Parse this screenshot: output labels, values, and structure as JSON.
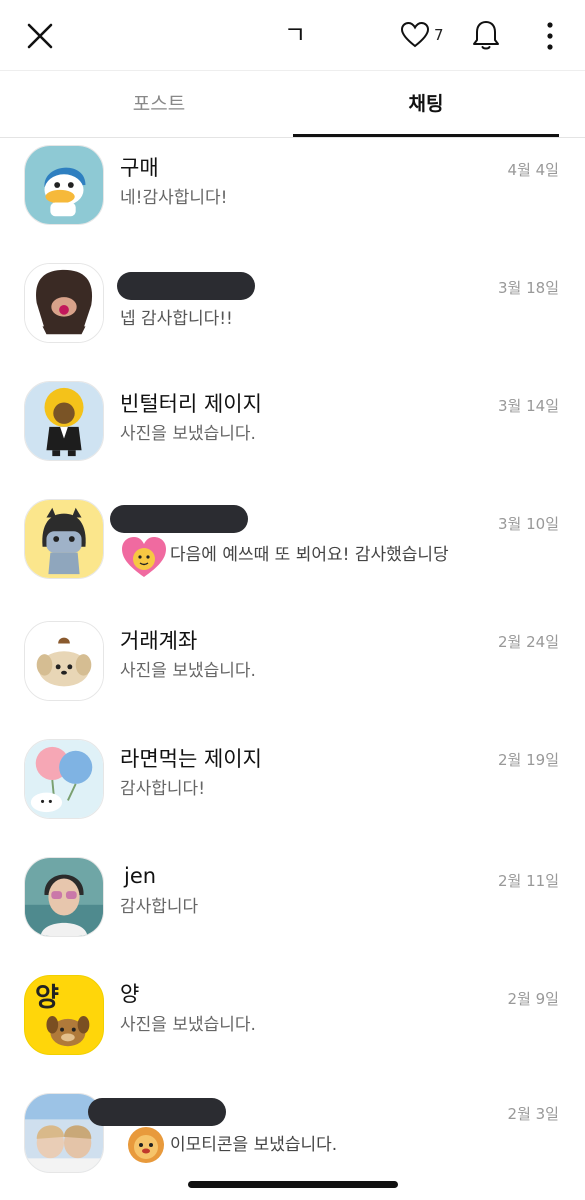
{
  "header": {
    "title": "ㄱ",
    "like_count": "7",
    "icons": {
      "close": "close-icon",
      "like": "heart-icon",
      "notify": "bell-icon",
      "menu": "more-vertical-icon"
    }
  },
  "tabs": [
    {
      "label": "포스트",
      "active": false
    },
    {
      "label": "채팅",
      "active": true
    }
  ],
  "chats": [
    {
      "name": "구매",
      "message": "네!감사합니다!",
      "date": "4월 4일",
      "avatar": "duck-character",
      "name_hidden": false
    },
    {
      "name": "",
      "message": "넵 감사합니다!!",
      "date": "3월 18일",
      "avatar": "dark-hair-character",
      "name_hidden": true
    },
    {
      "name": "빈털터리 제이지",
      "message": "사진을 보냈습니다.",
      "date": "3월 14일",
      "avatar": "afro-character-in-suit",
      "name_hidden": false
    },
    {
      "name": "",
      "message": "다음에 예쓰때 또 뵈어요! 감사했습니당",
      "date": "3월 10일",
      "avatar": "cat-character-yellow-bg",
      "name_hidden": true,
      "sticker": "heart-sticker"
    },
    {
      "name": "거래계좌",
      "message": "사진을 보냈습니다.",
      "date": "2월 24일",
      "avatar": "pudding-dog-character",
      "name_hidden": false
    },
    {
      "name": "라면먹는 제이지",
      "message": "감사합니다!",
      "date": "2월 19일",
      "avatar": "pastel-balloon-illustration",
      "name_hidden": false
    },
    {
      "name": "jen",
      "message": "감사합니다",
      "date": "2월 11일",
      "avatar": "person-photo",
      "name_hidden": false
    },
    {
      "name": "양",
      "message": "사진을 보냈습니다.",
      "date": "2월 9일",
      "avatar": "yang-text-character",
      "avatar_text": "양",
      "name_hidden": false
    },
    {
      "name": "",
      "message": "이모티콘을 보냈습니다.",
      "date": "2월 3일",
      "avatar": "group-photo",
      "name_hidden": true,
      "sticker": "lion-sticker"
    }
  ],
  "colors": {
    "accent": "#111111",
    "muted_text": "#666666",
    "date_text": "#999999",
    "redaction": "#2b2c31"
  }
}
